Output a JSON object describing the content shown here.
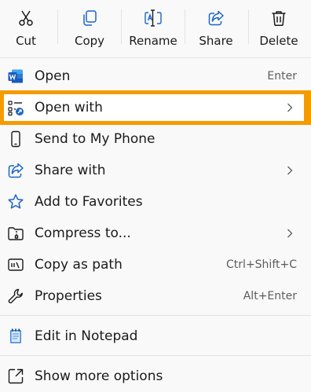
{
  "toolbar": {
    "items": [
      {
        "label": "Cut",
        "icon": "scissors-icon"
      },
      {
        "label": "Copy",
        "icon": "copy-icon"
      },
      {
        "label": "Rename",
        "icon": "rename-icon"
      },
      {
        "label": "Share",
        "icon": "share-icon"
      },
      {
        "label": "Delete",
        "icon": "trash-icon"
      }
    ]
  },
  "menu": {
    "items": [
      {
        "label": "Open",
        "accelerator": "Enter",
        "icon": "word-document-icon"
      },
      {
        "label": "Open with",
        "accelerator": "",
        "icon": "open-with-icon",
        "submenu": true,
        "highlighted": true
      },
      {
        "label": "Send to My Phone",
        "accelerator": "",
        "icon": "phone-icon"
      },
      {
        "label": "Share with",
        "accelerator": "",
        "icon": "share-icon",
        "submenu": true
      },
      {
        "label": "Add to Favorites",
        "accelerator": "",
        "icon": "star-icon"
      },
      {
        "label": "Compress to...",
        "accelerator": "",
        "icon": "zip-folder-icon",
        "submenu": true
      },
      {
        "label": "Copy as path",
        "accelerator": "Ctrl+Shift+C",
        "icon": "copy-path-icon"
      },
      {
        "label": "Properties",
        "accelerator": "Alt+Enter",
        "icon": "wrench-icon"
      },
      {
        "label": "Edit in Notepad",
        "accelerator": "",
        "icon": "notepad-icon"
      },
      {
        "label": "Show more options",
        "accelerator": "",
        "icon": "show-more-options-icon"
      }
    ]
  },
  "colors": {
    "highlight_border": "#f59b00",
    "accent_blue": "#1b64c6",
    "word_blue": "#185abd",
    "notepad_blue": "#3c86d8"
  }
}
